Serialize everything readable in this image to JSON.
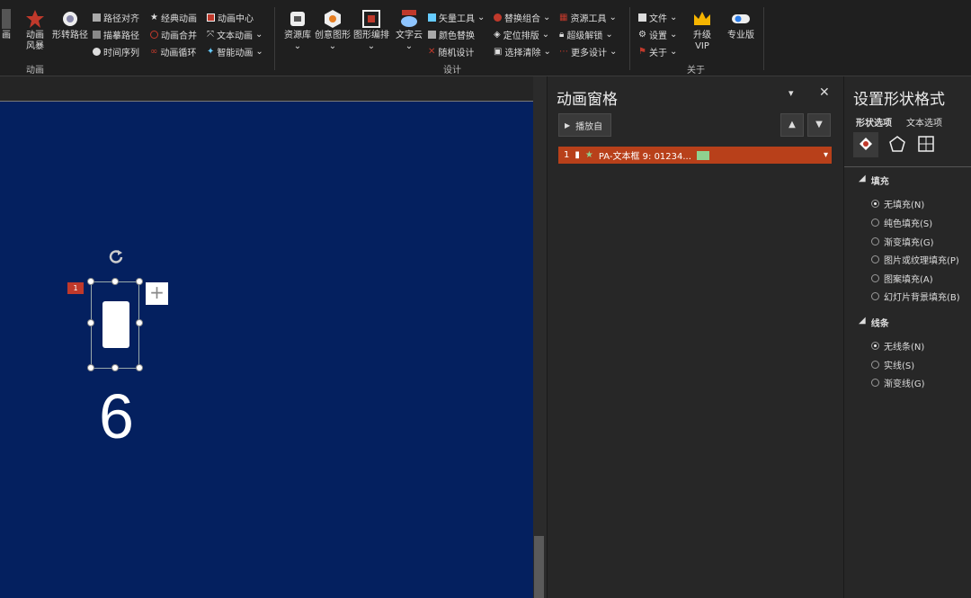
{
  "ribbon": {
    "group_anim": {
      "trunc_label": "画",
      "big1": "动画\n风暴",
      "big2": "形转路径",
      "small": [
        "路径对齐",
        "描摹路径",
        "时间序列",
        "经典动画",
        "动画合并",
        "动画循环",
        "动画中心",
        "文本动画",
        "智能动画"
      ],
      "label": "动画"
    },
    "group_design": {
      "big": [
        "资源库",
        "创意图形",
        "图形编排",
        "文字云"
      ],
      "small": [
        "矢量工具",
        "颜色替换",
        "随机设计",
        "替换组合",
        "定位排版",
        "选择清除",
        "资源工具",
        "超级解锁",
        "更多设计"
      ],
      "label": "设计"
    },
    "group_about": {
      "small": [
        "文件",
        "设置",
        "关于"
      ],
      "vip": "升级\nVIP",
      "pro": "专业版",
      "label": "关于"
    }
  },
  "slide": {
    "number": "6",
    "badge": "1"
  },
  "anim_pane": {
    "title": "动画窗格",
    "play_label": "播放自",
    "item_index": "1",
    "item_text": "PA-文本框 9: 01234..."
  },
  "format_pane": {
    "title": "设置形状格式",
    "tabs": [
      "形状选项",
      "文本选项"
    ],
    "fill_header": "填充",
    "fill_options": [
      "无填充(N)",
      "纯色填充(S)",
      "渐变填充(G)",
      "图片或纹理填充(P)",
      "图案填充(A)",
      "幻灯片背景填充(B)"
    ],
    "line_header": "线条",
    "line_options": [
      "无线条(N)",
      "实线(S)",
      "渐变线(G)"
    ]
  },
  "colors": {
    "slide_bg": "#04205f",
    "accent": "#c0392b",
    "anim_row": "#b8401a"
  }
}
